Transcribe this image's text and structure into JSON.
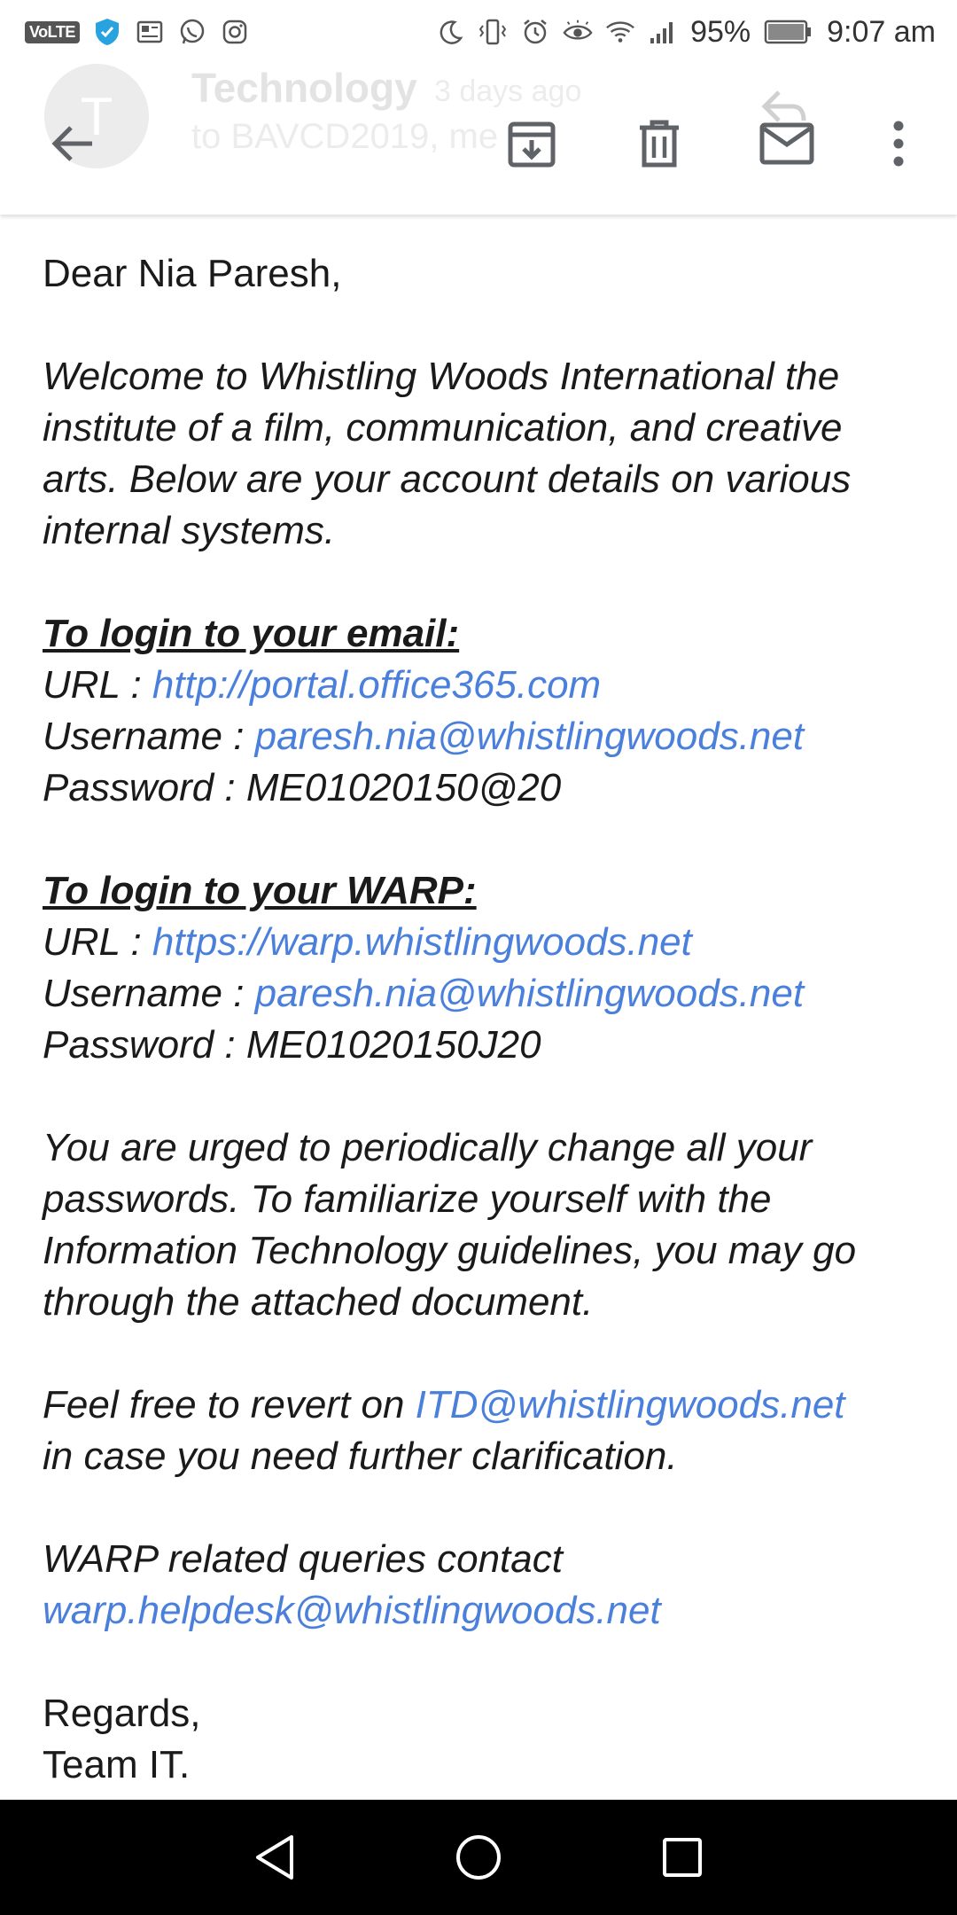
{
  "status_bar": {
    "volte": "VoLTE",
    "battery": "95%",
    "time": "9:07 am"
  },
  "header": {
    "ghost_avatar_letter": "T",
    "ghost_subject": "Technology",
    "ghost_time": "3 days ago",
    "ghost_to": "to BAVCD2019, me"
  },
  "email": {
    "greeting": "Dear Nia Paresh,",
    "intro": "Welcome to Whistling Woods International the institute of a film, communication, and creative arts. Below are your account details on various internal systems.",
    "email_section": {
      "heading": "To login to your email:",
      "url_label": "URL : ",
      "url": "http://portal.office365.com",
      "username_label": "Username : ",
      "username": "paresh.nia@whistlingwoods.net",
      "password_label": "Password : ",
      "password": "ME01020150@20"
    },
    "warp_section": {
      "heading": "To login to your WARP:",
      "url_label": "URL : ",
      "url": "https://warp.whistlingwoods.net",
      "username_label": "Username : ",
      "username": "paresh.nia@whistlingwoods.net",
      "password_label": "Password : ",
      "password": "ME01020150J20"
    },
    "advice": "You are urged to periodically change all your passwords. To familiarize yourself with the Information Technology guidelines, you may go through the attached document.",
    "revert_prefix": "Feel free to revert on ",
    "revert_email": "ITD@whistlingwoods.net",
    "revert_suffix": "in case you need further clarification.",
    "warp_queries": "WARP related queries contact",
    "warp_helpdesk": "warp.helpdesk@whistlingwoods.net",
    "regards": "Regards,",
    "signature": "Team IT."
  },
  "colors": {
    "link": "#4a80dc",
    "icon": "#5f6368",
    "nav_bar": "#000000"
  }
}
